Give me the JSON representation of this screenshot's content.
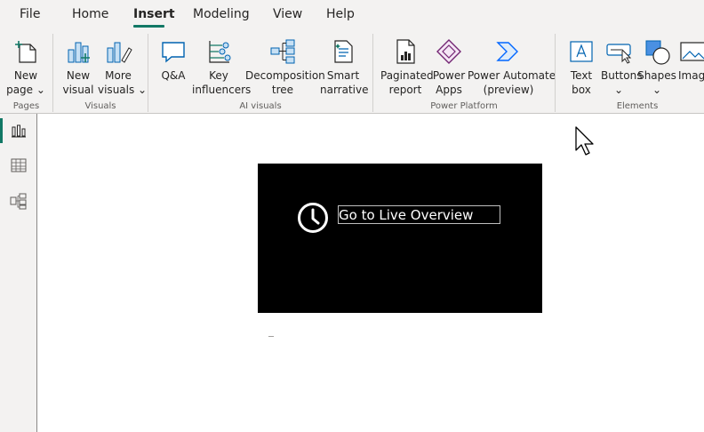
{
  "menu": {
    "tabs": [
      {
        "label": "File"
      },
      {
        "label": "Home"
      },
      {
        "label": "Insert"
      },
      {
        "label": "Modeling"
      },
      {
        "label": "View"
      },
      {
        "label": "Help"
      }
    ],
    "active_tab": "Insert",
    "accent_color": "#117865"
  },
  "ribbon": {
    "groups": {
      "pages": "Pages",
      "visuals": "Visuals",
      "ai_visuals": "AI visuals",
      "power_platform": "Power Platform",
      "elements": "Elements"
    },
    "buttons": {
      "new_page": {
        "line1": "New",
        "line2": "page ⌄",
        "icon": "new-page-icon"
      },
      "new_visual": {
        "line1": "New",
        "line2": "visual",
        "icon": "bar-chart-icon"
      },
      "more_visuals": {
        "line1": "More",
        "line2": "visuals ⌄",
        "icon": "more-visuals-icon"
      },
      "qa": {
        "line1": "Q&A",
        "line2": "",
        "icon": "qa-speech-bubble-icon"
      },
      "key_influencers": {
        "line1": "Key",
        "line2": "influencers",
        "icon": "key-influencers-icon"
      },
      "decomposition_tree": {
        "line1": "Decomposition",
        "line2": "tree",
        "icon": "decomposition-tree-icon"
      },
      "smart_narrative": {
        "line1": "Smart",
        "line2": "narrative",
        "icon": "smart-narrative-icon"
      },
      "paginated_report": {
        "line1": "Paginated",
        "line2": "report",
        "icon": "paginated-report-icon"
      },
      "power_apps": {
        "line1": "Power",
        "line2": "Apps",
        "icon": "power-apps-icon"
      },
      "power_automate": {
        "line1": "Power Automate",
        "line2": "(preview)",
        "icon": "power-automate-icon"
      },
      "text_box": {
        "line1": "Text",
        "line2": "box",
        "icon": "text-box-icon"
      },
      "buttons": {
        "line1": "Buttons",
        "line2": "⌄",
        "icon": "button-cursor-icon"
      },
      "shapes": {
        "line1": "Shapes",
        "line2": "⌄",
        "icon": "shapes-icon"
      },
      "image": {
        "line1": "Image",
        "line2": "",
        "icon": "image-icon"
      }
    }
  },
  "leftnav": {
    "items": [
      {
        "name": "report-view",
        "icon": "bar-chart-icon",
        "active": true
      },
      {
        "name": "data-view",
        "icon": "table-icon",
        "active": false
      },
      {
        "name": "model-view",
        "icon": "model-icon",
        "active": false
      }
    ]
  },
  "canvas": {
    "button_visual": {
      "text": "Go to Live Overview",
      "icon": "clock-icon",
      "background": "#000000",
      "text_color": "#ffffff"
    }
  }
}
